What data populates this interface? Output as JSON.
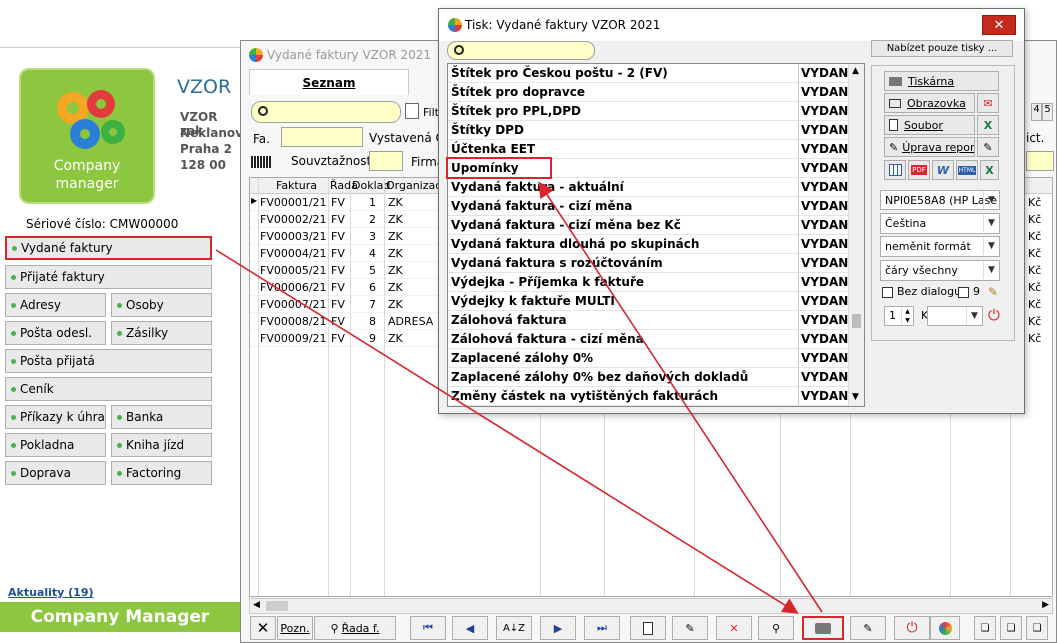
{
  "company": {
    "logo_text_line1": "Company",
    "logo_text_line2": "manager",
    "title": "VZOR",
    "address": [
      "VZOR zak",
      "Neklanov",
      "Praha 2",
      "128 00"
    ],
    "serial": "Sériové číslo: CMW00000",
    "news": "Aktuality (19)",
    "footer": "Company Manager"
  },
  "nav": {
    "vydane": "Vydané faktury",
    "prijate": "Přijaté faktury",
    "adresy": "Adresy",
    "osoby": "Osoby",
    "posta_odesl": "Pošta odesl.",
    "zasilky": "Zásilky",
    "posta_prijata": "Pošta přijatá",
    "cenik": "Ceník",
    "prikazy": "Příkazy k úhradě",
    "banka": "Banka",
    "pokladna": "Pokladna",
    "kniha_jizd": "Kniha jízd",
    "doprava": "Doprava",
    "factoring": "Factoring"
  },
  "invoice_window": {
    "title": "Vydané faktury VZOR  2021",
    "tab": "Seznam",
    "filter_label": "Filt",
    "fa_label": "Fa.",
    "vystavena_label": "Vystavená Od",
    "souvztaznost_label": "Souvztažnost",
    "firma_label": "Firma",
    "ict_label": "ict.",
    "tab4": "4",
    "tab5": "5",
    "columns": [
      "Faktura",
      "Řada",
      "Doklad",
      "Organizace"
    ],
    "rows": [
      {
        "faktura": "FV00001/21",
        "rada": "FV",
        "doklad": "1",
        "org": "ZK"
      },
      {
        "faktura": "FV00002/21",
        "rada": "FV",
        "doklad": "2",
        "org": "ZK"
      },
      {
        "faktura": "FV00003/21",
        "rada": "FV",
        "doklad": "3",
        "org": "ZK"
      },
      {
        "faktura": "FV00004/21",
        "rada": "FV",
        "doklad": "4",
        "org": "ZK"
      },
      {
        "faktura": "FV00005/21",
        "rada": "FV",
        "doklad": "5",
        "org": "ZK"
      },
      {
        "faktura": "FV00006/21",
        "rada": "FV",
        "doklad": "6",
        "org": "ZK"
      },
      {
        "faktura": "FV00007/21",
        "rada": "FV",
        "doklad": "7",
        "org": "ZK"
      },
      {
        "faktura": "FV00008/21",
        "rada": "FV",
        "doklad": "8",
        "org": "ADRESA"
      },
      {
        "faktura": "FV00009/21",
        "rada": "FV",
        "doklad": "9",
        "org": "ZK"
      }
    ],
    "right_values": [
      "Kč",
      "Kč",
      "Kč",
      "Kč",
      "Kč",
      "Kč",
      "Kč",
      "Kč",
      "Kč"
    ],
    "toolbar": {
      "close": "✕",
      "pozn": "Pozn.",
      "rada": "Řada f."
    }
  },
  "print_dialog": {
    "title": "Tisk: Vydané faktury VZOR  2021",
    "offer_button": "Nabízet pouze tisky ...",
    "items": [
      {
        "name": "Štítek pro Českou poštu - 2 (FV)",
        "state": "VYDANI"
      },
      {
        "name": "Štítek pro dopravce",
        "state": "VYDANI"
      },
      {
        "name": "Štítek pro PPL,DPD",
        "state": "VYDANI"
      },
      {
        "name": "Štítky DPD",
        "state": "VYDANI"
      },
      {
        "name": "Účtenka EET",
        "state": "VYDANI"
      },
      {
        "name": "Upomínky",
        "state": "VYDANI"
      },
      {
        "name": "Vydaná faktura - aktuální",
        "state": "VYDANI"
      },
      {
        "name": "Vydaná faktura - cizí měna",
        "state": "VYDANI"
      },
      {
        "name": "Vydaná faktura - cizí měna bez Kč",
        "state": "VYDANI"
      },
      {
        "name": "Vydaná faktura dlouhá po skupinách",
        "state": "VYDANI"
      },
      {
        "name": "Vydaná faktura s rozúčtováním",
        "state": "VYDANI"
      },
      {
        "name": "Výdejka - Příjemka k faktuře",
        "state": "VYDANI"
      },
      {
        "name": "Výdejky k faktuře MULTI",
        "state": "VYDANI"
      },
      {
        "name": "Zálohová faktura",
        "state": "VYDANI"
      },
      {
        "name": "Zálohová faktura - cizí měna",
        "state": "VYDANI"
      },
      {
        "name": "Zaplacené zálohy 0%",
        "state": "VYDANI"
      },
      {
        "name": "Zaplacené zálohy 0% bez daňových dokladů",
        "state": "VYDANI"
      },
      {
        "name": "Změny částek na vytištěných fakturách",
        "state": "VYDANI"
      }
    ],
    "buttons": {
      "tiskarna": "Tiskárna",
      "obrazovka": "Obrazovka",
      "soubor": "Soubor",
      "uprava": "Úprava repor",
      "pdf": "PDF",
      "word": "W",
      "html": "HTML"
    },
    "printer": "NPI0E58A8 (HP Lase",
    "language": "Čeština",
    "format": "neměnit formát",
    "lines": "čáry všechny",
    "bez_dialogu": "Bez dialogu",
    "copies_nine": "9",
    "count": "1",
    "k_label": "K"
  },
  "colors": {
    "accent_green": "#8dc63f",
    "highlight_red": "#d9262c"
  }
}
